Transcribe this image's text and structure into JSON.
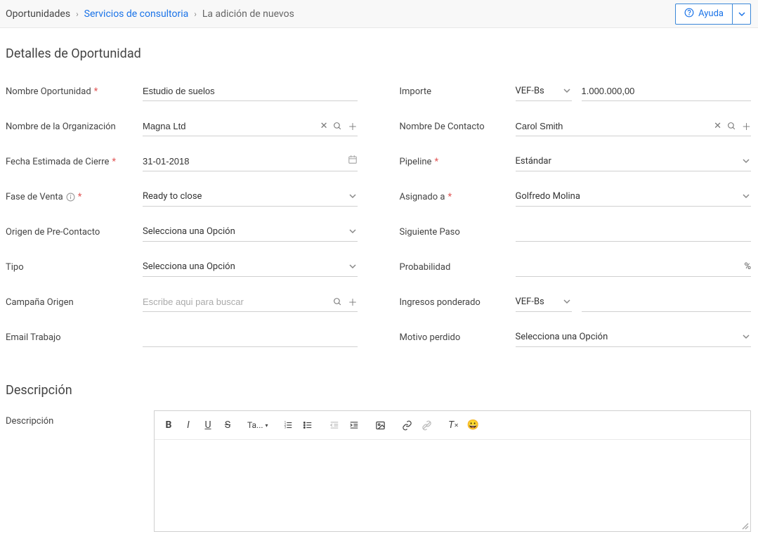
{
  "breadcrumb": {
    "root": "Oportunidades",
    "link": "Servicios de consultoria",
    "current": "La adición de nuevos"
  },
  "help": {
    "label": "Ayuda"
  },
  "sections": {
    "details_title": "Detalles de Oportunidad",
    "description_title": "Descripción"
  },
  "labels": {
    "opp_name": "Nombre Oportunidad",
    "org_name": "Nombre de la Organización",
    "close_date": "Fecha Estimada de Cierre",
    "sales_stage": "Fase de Venta",
    "lead_source": "Origen de Pre-Contacto",
    "type": "Tipo",
    "campaign": "Campaña Origen",
    "work_email": "Email Trabajo",
    "amount": "Importe",
    "contact_name": "Nombre De Contacto",
    "pipeline": "Pipeline",
    "assigned_to": "Asignado a",
    "next_step": "Siguiente Paso",
    "probability": "Probabilidad",
    "weighted_revenue": "Ingresos ponderado",
    "lost_reason": "Motivo perdido",
    "description": "Descripción"
  },
  "values": {
    "opp_name": "Estudio de suelos",
    "org_name": "Magna Ltd",
    "close_date": "31-01-2018",
    "sales_stage": "Ready to close",
    "lead_source": "Selecciona una Opción",
    "type": "Selecciona una Opción",
    "campaign_placeholder": "Escribe aqui para buscar",
    "work_email": "",
    "amount_currency": "VEF-Bs",
    "amount_value": "1.000.000,00",
    "contact_name": "Carol Smith",
    "pipeline": "Estándar",
    "assigned_to": "Golfredo Molina",
    "next_step": "",
    "probability": "",
    "weighted_currency": "VEF-Bs",
    "weighted_value": "",
    "lost_reason": "Selecciona una Opción",
    "percent_suffix": "%"
  },
  "editor": {
    "font_label": "Ta..."
  }
}
